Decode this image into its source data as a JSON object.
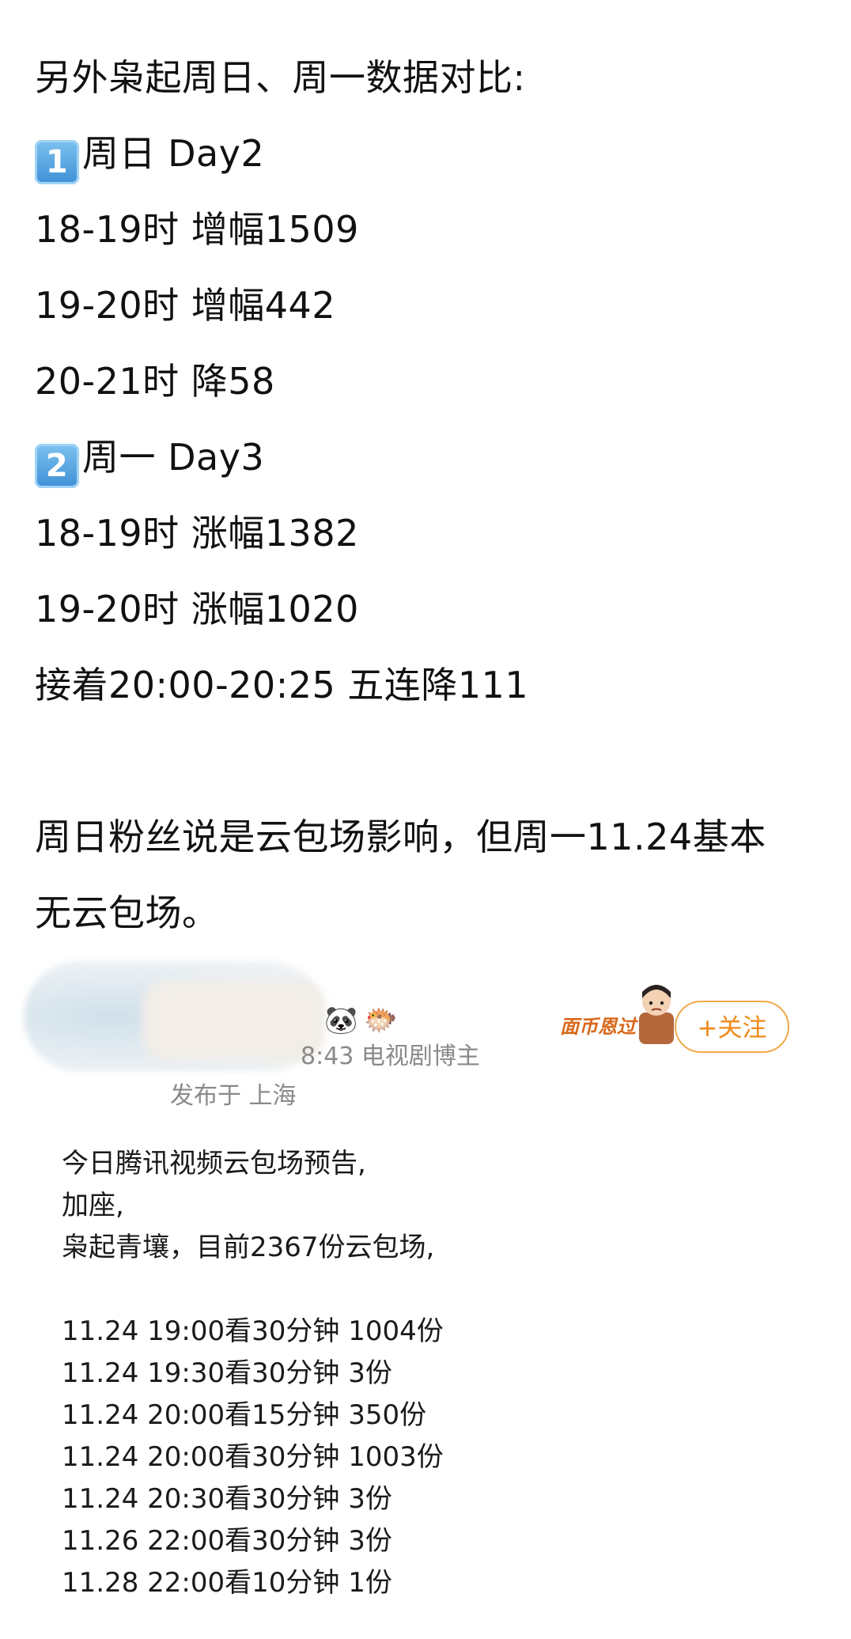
{
  "post": {
    "heading": "另外枭起周日、周一数据对比:",
    "section1": {
      "badge": "1",
      "label": "周日 Day2"
    },
    "section1_lines": [
      "18-19时 增幅1509",
      "19-20时 增幅442",
      "20-21时 降58"
    ],
    "section2": {
      "badge": "2",
      "label": "周一 Day3"
    },
    "section2_lines": [
      "18-19时 涨幅1382",
      "19-20时 涨幅1020",
      "接着20:00-20:25 五连降111"
    ],
    "conclusion_line1": "周日粉丝说是云包场影响，但周一11.24基本",
    "conclusion_line2": "无云包场。"
  },
  "quote": {
    "emoji1": "🐼",
    "emoji2": "🐡",
    "meta_time_suffix": "8:43  电视剧博主",
    "location": "发布于 上海",
    "badge_text": "面币恩过",
    "follow_label": "+关注",
    "lines": [
      "今日腾讯视频云包场预告,",
      "加座,",
      "枭起青壤，目前2367份云包场,",
      "",
      "11.24 19:00看30分钟 1004份",
      "11.24 19:30看30分钟 3份",
      "11.24 20:00看15分钟 350份",
      "11.24 20:00看30分钟 1003份",
      "11.24 20:30看30分钟 3份",
      "11.26 22:00看30分钟 3份",
      "11.28 22:00看10分钟 1份"
    ]
  }
}
